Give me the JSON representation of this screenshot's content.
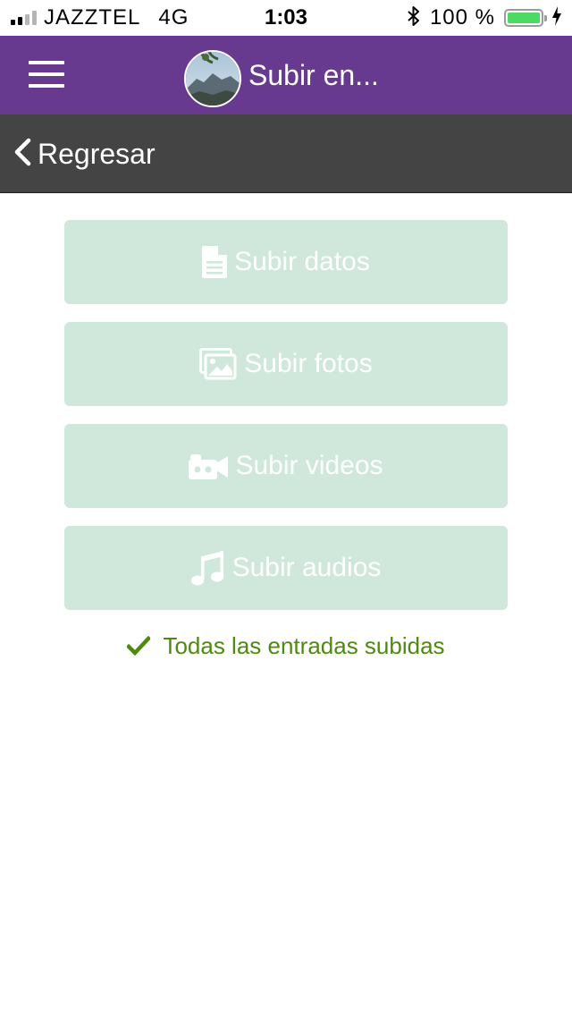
{
  "status_bar": {
    "carrier": "JAZZTEL",
    "network": "4G",
    "time": "1:03",
    "battery": "100 %",
    "battery_level": 1.0,
    "signal_bars_filled": 2,
    "signal_bars_total": 4,
    "icons": [
      "signal-icon",
      "bluetooth-icon",
      "battery-icon",
      "charging-icon"
    ]
  },
  "app_bar": {
    "title": "Subir en...",
    "menu_icon": "hamburger-menu-icon",
    "avatar_icon": "project-avatar"
  },
  "nav": {
    "back_label": "Regresar",
    "back_icon": "chevron-left-icon"
  },
  "actions": [
    {
      "label": "Subir datos",
      "icon": "document-icon"
    },
    {
      "label": "Subir fotos",
      "icon": "images-icon"
    },
    {
      "label": "Subir videos",
      "icon": "video-camera-icon"
    },
    {
      "label": "Subir audios",
      "icon": "music-note-icon"
    }
  ],
  "status_message": {
    "text": "Todas las entradas subidas",
    "icon": "checkmark-icon"
  },
  "colors": {
    "app_bar": "#673a8f",
    "sub_bar": "#444444",
    "button_bg": "#d0e8dc",
    "button_text": "#ffffff",
    "success": "#4f8a10",
    "battery_fill": "#4cd964"
  }
}
